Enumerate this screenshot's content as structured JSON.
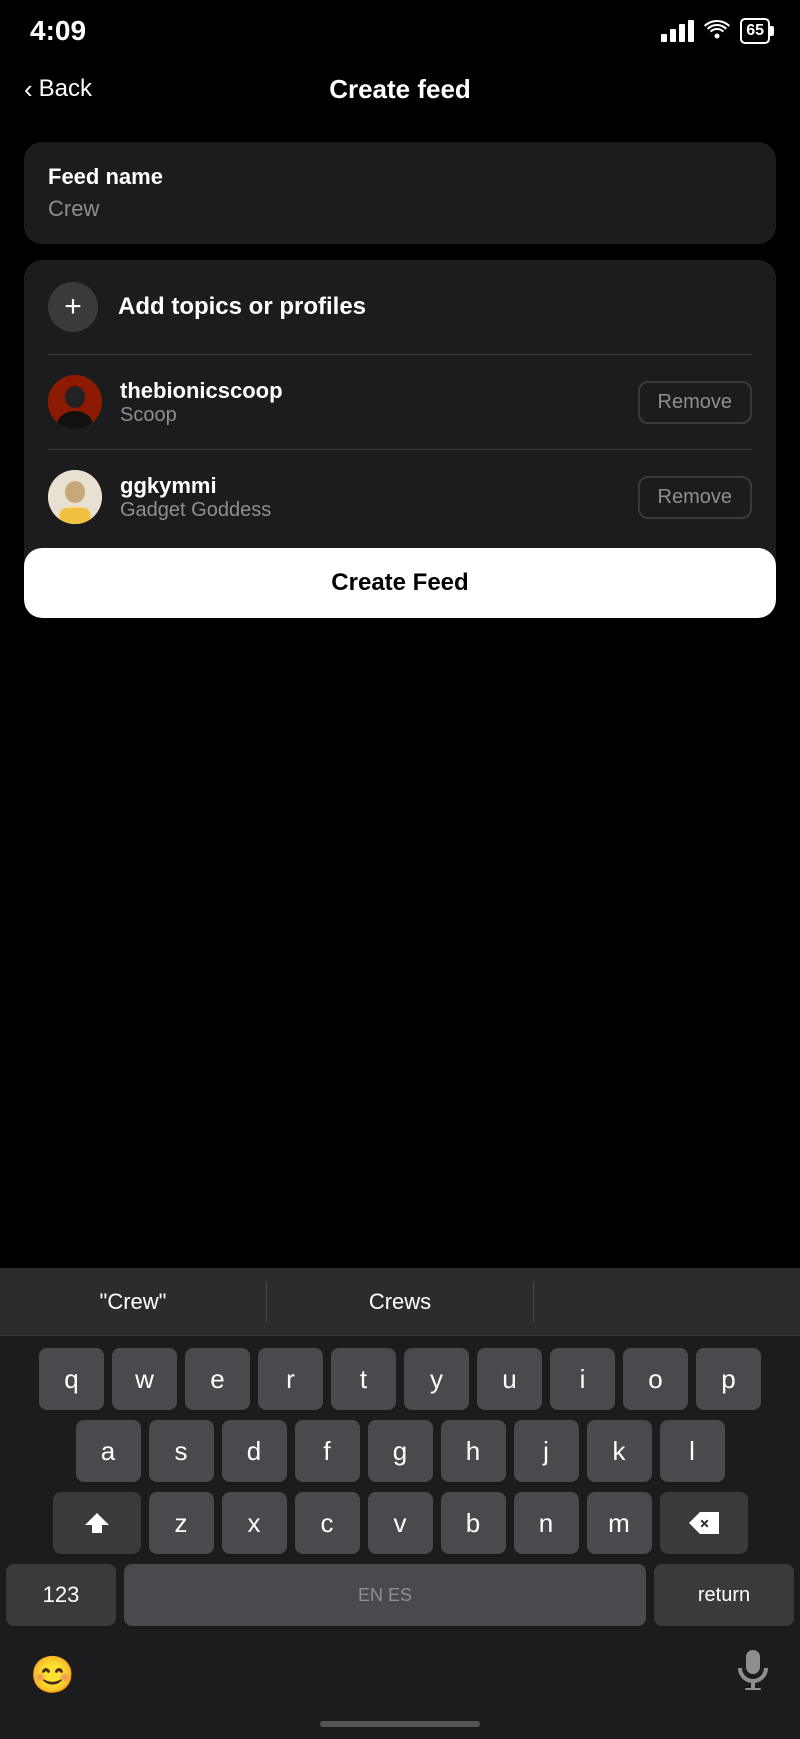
{
  "statusBar": {
    "time": "4:09",
    "battery": "65"
  },
  "navBar": {
    "backLabel": "Back",
    "title": "Create feed"
  },
  "feedNameCard": {
    "label": "Feed name",
    "value": "Crew"
  },
  "topicsCard": {
    "addLabel": "Add topics or profiles",
    "profiles": [
      {
        "username": "thebionicscoop",
        "displayName": "Scoop",
        "removeLabel": "Remove"
      },
      {
        "username": "ggkymmi",
        "displayName": "Gadget Goddess",
        "removeLabel": "Remove"
      }
    ]
  },
  "createFeedButton": {
    "label": "Create Feed"
  },
  "autocomplete": {
    "items": [
      "\"Crew\"",
      "Crews",
      ""
    ]
  },
  "keyboard": {
    "rows": [
      [
        "q",
        "w",
        "e",
        "r",
        "t",
        "y",
        "u",
        "i",
        "o",
        "p"
      ],
      [
        "a",
        "s",
        "d",
        "f",
        "g",
        "h",
        "j",
        "k",
        "l"
      ],
      [
        "z",
        "x",
        "c",
        "v",
        "b",
        "n",
        "m"
      ]
    ],
    "num123Label": "123",
    "spaceLabel": "EN ES",
    "returnLabel": "return"
  }
}
